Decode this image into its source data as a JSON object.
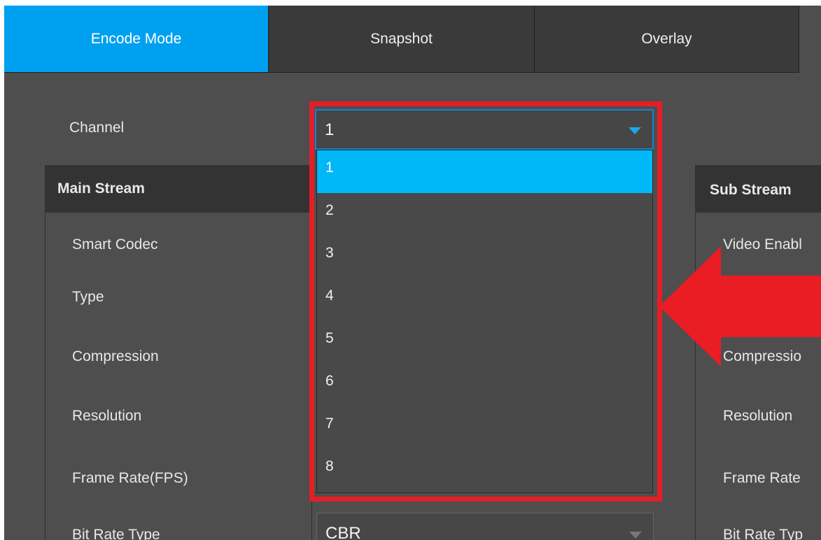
{
  "tabs": [
    {
      "label": "Encode Mode",
      "active": true
    },
    {
      "label": "Snapshot",
      "active": false
    },
    {
      "label": "Overlay",
      "active": false
    }
  ],
  "channel": {
    "label": "Channel",
    "selected_value": "1",
    "options": [
      "1",
      "2",
      "3",
      "4",
      "5",
      "6",
      "7",
      "8"
    ]
  },
  "main_stream": {
    "title": "Main Stream",
    "fields": [
      "Smart Codec",
      "Type",
      "Compression",
      "Resolution",
      "Frame Rate(FPS)",
      "Bit Rate Type"
    ],
    "bit_rate_type_value": "CBR"
  },
  "sub_stream": {
    "title": "Sub Stream",
    "fields": [
      "Video Enabl",
      "Compressio",
      "Resolution",
      "Frame Rate",
      "Bit Rate Typ"
    ]
  },
  "colors": {
    "accent": "#00a0f0",
    "highlight": "#e41e26",
    "background": "#4e4e4e"
  }
}
